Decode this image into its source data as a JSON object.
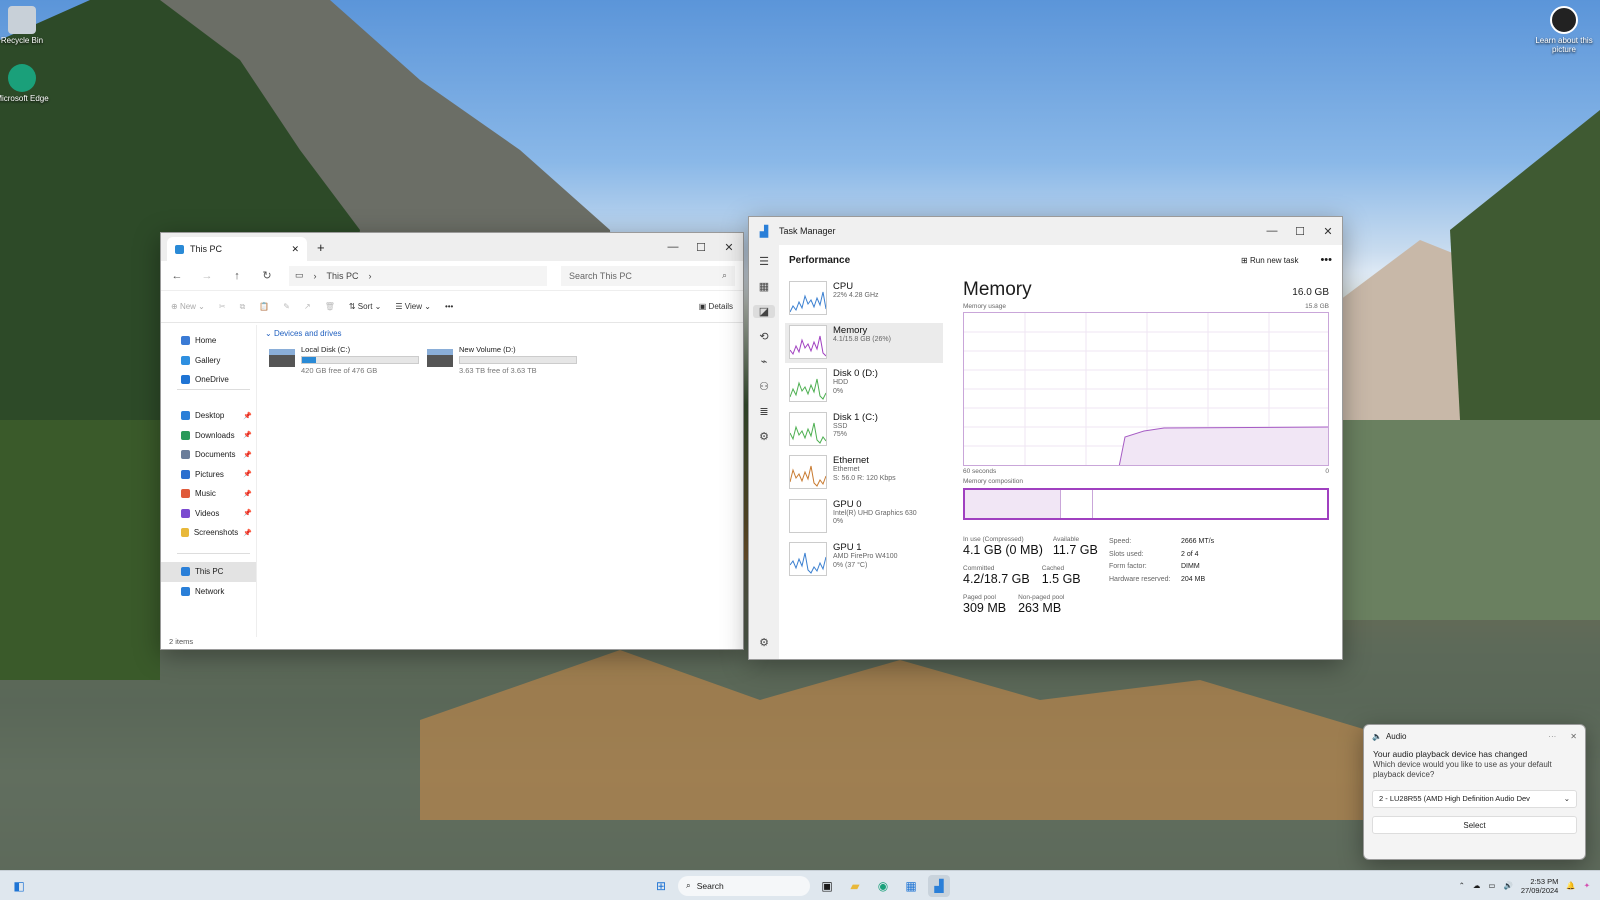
{
  "desktop": {
    "recycle_bin": "Recycle Bin",
    "edge": "Microsoft Edge",
    "learn": "Learn about this picture"
  },
  "explorer": {
    "tab_title": "This PC",
    "breadcrumb": "This PC",
    "search_placeholder": "Search This PC",
    "toolbar": {
      "new": "New",
      "sort": "Sort",
      "view": "View",
      "details": "Details"
    },
    "nav": [
      {
        "label": "Home",
        "color": "#3a7bd5",
        "pinned": false
      },
      {
        "label": "Gallery",
        "color": "#2f8fe0",
        "pinned": false
      },
      {
        "label": "OneDrive",
        "color": "#1f74d4",
        "pinned": false
      },
      {
        "label": "Desktop",
        "color": "#2b7fd8",
        "pinned": true
      },
      {
        "label": "Downloads",
        "color": "#2a9a5a",
        "pinned": true
      },
      {
        "label": "Documents",
        "color": "#6a7d9a",
        "pinned": true
      },
      {
        "label": "Pictures",
        "color": "#2b6fcf",
        "pinned": true
      },
      {
        "label": "Music",
        "color": "#e05a3a",
        "pinned": true
      },
      {
        "label": "Videos",
        "color": "#7a4ad0",
        "pinned": true
      },
      {
        "label": "Screenshots",
        "color": "#e8b83a",
        "pinned": true
      },
      {
        "label": "This PC",
        "color": "#2a7fd8",
        "pinned": false
      },
      {
        "label": "Network",
        "color": "#2a7fd8",
        "pinned": false
      }
    ],
    "section": "Devices and drives",
    "drives": [
      {
        "name": "Local Disk (C:)",
        "free": "420 GB free of 476 GB",
        "used_fraction": 0.12
      },
      {
        "name": "New Volume (D:)",
        "free": "3.63 TB free of 3.63 TB",
        "used_fraction": 0.0
      }
    ],
    "status": "2 items"
  },
  "taskmgr": {
    "title": "Task Manager",
    "page": "Performance",
    "run_new_task": "Run new task",
    "items": [
      {
        "name": "CPU",
        "sub1": "22%  4.28 GHz",
        "sub2": "",
        "sub3": "",
        "color": "#3a7fd0"
      },
      {
        "name": "Memory",
        "sub1": "4.1/15.8 GB (26%)",
        "sub2": "",
        "sub3": "",
        "color": "#a040c0"
      },
      {
        "name": "Disk 0 (D:)",
        "sub1": "HDD",
        "sub2": "0%",
        "sub3": "",
        "color": "#4caf50"
      },
      {
        "name": "Disk 1 (C:)",
        "sub1": "SSD",
        "sub2": "75%",
        "sub3": "",
        "color": "#4caf50"
      },
      {
        "name": "Ethernet",
        "sub1": "Ethernet",
        "sub2": "S: 56.0  R: 120 Kbps",
        "sub3": "",
        "color": "#c87a30"
      },
      {
        "name": "GPU 0",
        "sub1": "Intel(R) UHD Graphics 630",
        "sub2": "0%",
        "sub3": "",
        "color": "#3a7fd0"
      },
      {
        "name": "GPU 1",
        "sub1": "AMD FirePro W4100",
        "sub2": "0% (37 °C)",
        "sub3": "",
        "color": "#3a7fd0"
      }
    ],
    "memory": {
      "heading": "Memory",
      "total": "16.0 GB",
      "usage_label": "Memory usage",
      "max_label": "15.8 GB",
      "axis_left": "60 seconds",
      "axis_right": "0",
      "composition_label": "Memory composition",
      "stats": {
        "in_use_k": "In use (Compressed)",
        "in_use_v": "4.1 GB (0 MB)",
        "available_k": "Available",
        "available_v": "11.7 GB",
        "committed_k": "Committed",
        "committed_v": "4.2/18.7 GB",
        "cached_k": "Cached",
        "cached_v": "1.5 GB",
        "paged_k": "Paged pool",
        "paged_v": "309 MB",
        "nonpaged_k": "Non-paged pool",
        "nonpaged_v": "263 MB"
      },
      "right": [
        {
          "k": "Speed:",
          "v": "2666 MT/s"
        },
        {
          "k": "Slots used:",
          "v": "2 of 4"
        },
        {
          "k": "Form factor:",
          "v": "DIMM"
        },
        {
          "k": "Hardware reserved:",
          "v": "204 MB"
        }
      ]
    }
  },
  "audio": {
    "app": "Audio",
    "title": "Your audio playback device has changed",
    "body": "Which device would you like to use as your default playback device?",
    "selected": "2 - LU28R55 (AMD High Definition Audio Dev",
    "button": "Select"
  },
  "taskbar": {
    "search": "Search",
    "time": "2:53 PM",
    "date": "27/09/2024"
  }
}
